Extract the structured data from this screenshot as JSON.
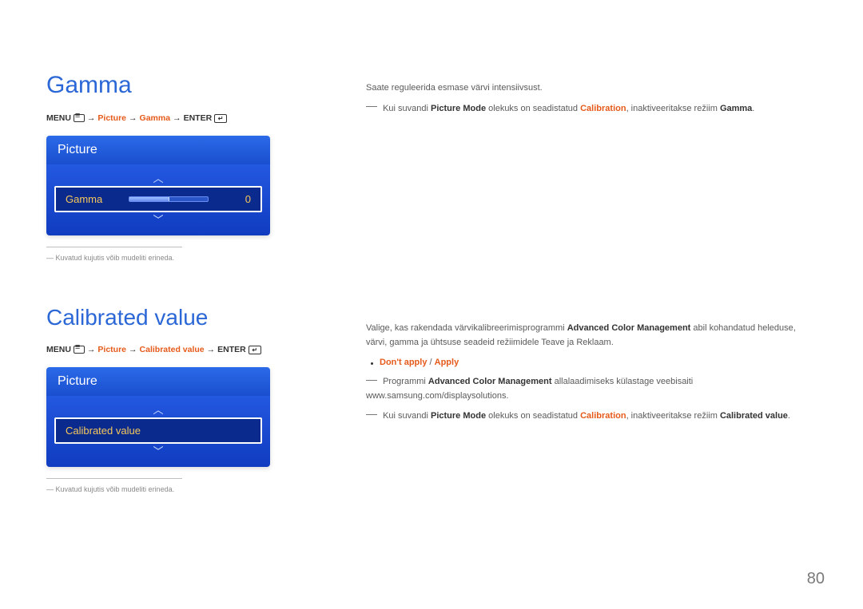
{
  "gamma": {
    "title": "Gamma",
    "breadcrumb": {
      "menu": "MENU",
      "arrow": "→",
      "picture": "Picture",
      "item": "Gamma",
      "enter": "ENTER"
    },
    "osd": {
      "panel_title": "Picture",
      "row_label": "Gamma",
      "row_value": "0"
    },
    "caption": "―  Kuvatud kujutis võib mudeliti erineda.",
    "body": {
      "line1": "Saate reguleerida esmase värvi intensiivsust.",
      "line2_pre": "Kui suvandi ",
      "line2_pm": "Picture Mode",
      "line2_mid": " olekuks on seadistatud ",
      "line2_cal": "Calibration",
      "line2_mid2": ", inaktiveeritakse režiim ",
      "line2_g": "Gamma",
      "line2_end": "."
    }
  },
  "calibrated": {
    "title": "Calibrated value",
    "breadcrumb": {
      "menu": "MENU",
      "arrow": "→",
      "picture": "Picture",
      "item": "Calibrated value",
      "enter": "ENTER"
    },
    "osd": {
      "panel_title": "Picture",
      "row_label": "Calibrated value"
    },
    "caption": "―  Kuvatud kujutis võib mudeliti erineda.",
    "body": {
      "line1_pre": "Valige, kas rakendada värvikalibreerimisprogrammi ",
      "line1_acm": "Advanced Color Management",
      "line1_post": " abil kohandatud heleduse, värvi, gamma ja ühtsuse seadeid režiimidele Teave ja Reklaam.",
      "options_dont": "Don't apply",
      "options_sep": " / ",
      "options_apply": "Apply",
      "line3_pre": "Programmi ",
      "line3_acm": "Advanced Color Management",
      "line3_post": " allalaadimiseks külastage veebisaiti www.samsung.com/displaysolutions.",
      "line4_pre": "Kui suvandi ",
      "line4_pm": "Picture Mode",
      "line4_mid": " olekuks on seadistatud ",
      "line4_cal": "Calibration",
      "line4_mid2": ", inaktiveeritakse režiim ",
      "line4_cv": "Calibrated value",
      "line4_end": "."
    }
  },
  "page_number": "80"
}
